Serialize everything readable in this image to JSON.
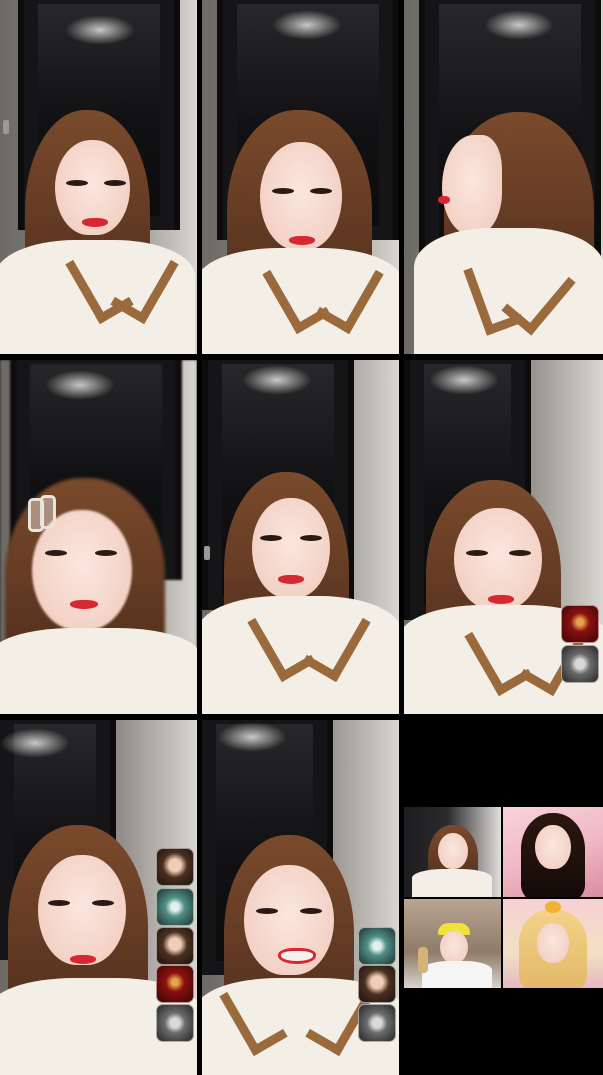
{
  "screen": {
    "type": "multi-guest live video grid",
    "background": "#000000"
  },
  "tiles": [
    {
      "id": "guest-1",
      "scene": "door"
    },
    {
      "id": "guest-2",
      "scene": "door"
    },
    {
      "id": "guest-3",
      "scene": "door-profile"
    },
    {
      "id": "guest-4",
      "scene": "door-blur"
    },
    {
      "id": "guest-5",
      "scene": "door"
    },
    {
      "id": "guest-6",
      "scene": "door",
      "side_avatars": [
        "red-room-avatar",
        "bubble-avatar"
      ]
    },
    {
      "id": "guest-7",
      "scene": "door",
      "side_avatars": [
        "face-avatar",
        "teal-bubble-avatar",
        "portrait-avatar",
        "red-room-avatar",
        "bubble-avatar"
      ]
    },
    {
      "id": "guest-8",
      "scene": "door",
      "side_avatars": [
        "teal-bubble-avatar",
        "face-avatar",
        "bubble-avatar"
      ]
    },
    {
      "id": "guest-9",
      "scene": "quad-grid",
      "sub_tiles": [
        "mini-guest-a",
        "mini-guest-b",
        "mini-guest-c",
        "mini-guest-d"
      ]
    }
  ],
  "colors": {
    "accent_lips": "#d62830",
    "hair": "#6a3f25",
    "top": "#f3efe7",
    "collar": "#9a6a3c"
  }
}
